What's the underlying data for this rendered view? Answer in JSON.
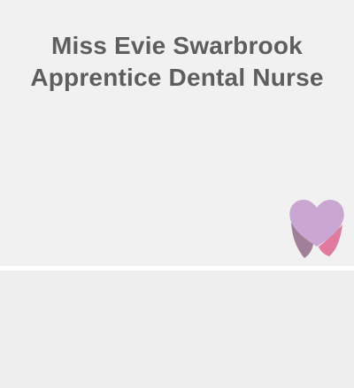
{
  "profile": {
    "name": "Miss Evie Swarbrook",
    "role": "Apprentice Dental Nurse"
  },
  "logo": {
    "icon": "tooth-heart-icon",
    "colors": {
      "heart": "#c9a7d2",
      "left_root": "#a07f98",
      "right_root": "#e07a9e"
    }
  },
  "colors": {
    "background": "#efefef",
    "text": "#5e5e5e",
    "divider": "#ffffff"
  }
}
